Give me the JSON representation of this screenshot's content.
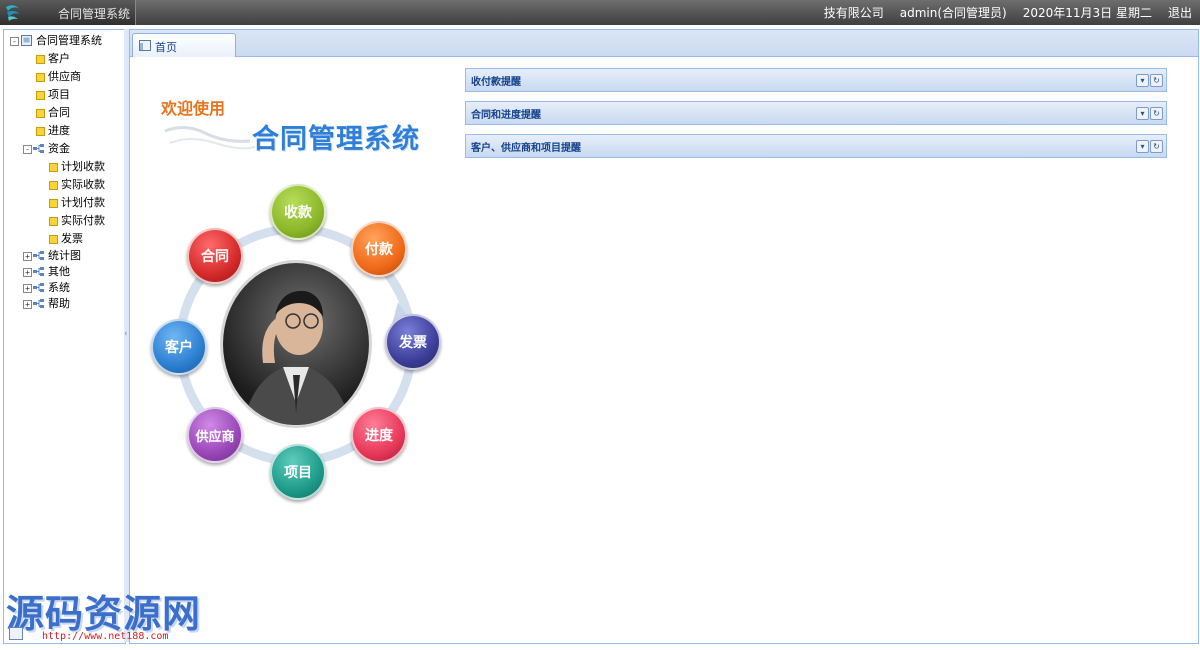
{
  "header": {
    "app_title": "合同管理系统",
    "company": "技有限公司",
    "user": "admin(合同管理员)",
    "date": "2020年11月3日 星期二",
    "logout_label": "退出"
  },
  "sidebar": {
    "root": "合同管理系统",
    "items": [
      {
        "label": "客户"
      },
      {
        "label": "供应商"
      },
      {
        "label": "项目"
      },
      {
        "label": "合同"
      },
      {
        "label": "进度"
      }
    ],
    "funds": {
      "label": "资金",
      "children": [
        "计划收款",
        "实际收款",
        "计划付款",
        "实际付款",
        "发票"
      ]
    },
    "collapsed": [
      "统计图",
      "其他",
      "系统",
      "帮助"
    ]
  },
  "tabs": [
    {
      "label": "首页"
    }
  ],
  "welcome": {
    "small": "欢迎使用",
    "title": "合同管理系统"
  },
  "diagram": {
    "nodes": [
      {
        "label": "收款",
        "color": "#8db82a"
      },
      {
        "label": "付款",
        "color": "#f06a1a"
      },
      {
        "label": "发票",
        "color": "#3d3f9a"
      },
      {
        "label": "进度",
        "color": "#e8395a"
      },
      {
        "label": "项目",
        "color": "#1f9a8a"
      },
      {
        "label": "供应商",
        "color": "#9a47b8"
      },
      {
        "label": "客户",
        "color": "#2d7fd0"
      },
      {
        "label": "合同",
        "color": "#d62a2a"
      }
    ]
  },
  "panels": [
    {
      "title": "收付款提醒"
    },
    {
      "title": "合同和进度提醒"
    },
    {
      "title": "客户、供应商和项目提醒"
    }
  ],
  "watermark": {
    "text": "源码资源网",
    "url": "http://www.net188.com"
  }
}
